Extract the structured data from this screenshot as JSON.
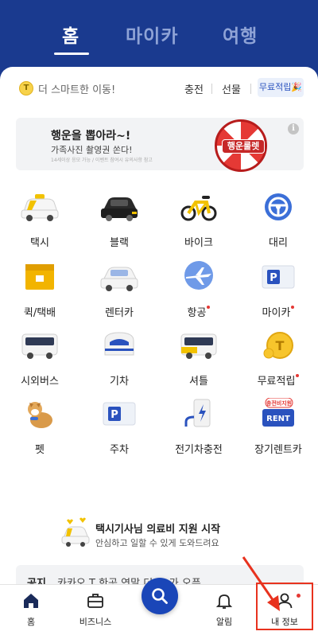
{
  "top_tabs": [
    {
      "label": "홈",
      "active": true
    },
    {
      "label": "마이카",
      "active": false
    },
    {
      "label": "여행",
      "active": false
    }
  ],
  "subbar": {
    "coin": "T",
    "tagline": "더 스마트한 이동!",
    "links": [
      "충전",
      "선물"
    ],
    "free_chip": "무료적립🎉"
  },
  "banner": {
    "title": "행운을 뽑아라~!",
    "subtitle": "가족사진 촬영권 쏜다!",
    "fine_print": "14세이상 응모 가능 / 이벤트 참여시 유의사항 참고",
    "wheel_label": "행운룰렛",
    "info": "i"
  },
  "services": [
    {
      "label": "택시",
      "icon": "taxi-icon",
      "new": false
    },
    {
      "label": "블랙",
      "icon": "black-car-icon",
      "new": false
    },
    {
      "label": "바이크",
      "icon": "bike-icon",
      "new": false
    },
    {
      "label": "대리",
      "icon": "steering-wheel-icon",
      "new": false
    },
    {
      "label": "퀵/택배",
      "icon": "box-icon",
      "new": false
    },
    {
      "label": "렌터카",
      "icon": "rental-car-icon",
      "new": false
    },
    {
      "label": "항공",
      "icon": "airplane-icon",
      "new": true
    },
    {
      "label": "마이카",
      "icon": "parking-ticket-icon",
      "new": true
    },
    {
      "label": "시외버스",
      "icon": "bus-icon",
      "new": false
    },
    {
      "label": "기차",
      "icon": "train-icon",
      "new": false
    },
    {
      "label": "셔틀",
      "icon": "shuttle-icon",
      "new": false
    },
    {
      "label": "무료적립",
      "icon": "coin-icon",
      "new": true
    },
    {
      "label": "펫",
      "icon": "dog-icon",
      "new": false
    },
    {
      "label": "주차",
      "icon": "parking-icon",
      "new": false
    },
    {
      "label": "전기차충전",
      "icon": "ev-charger-icon",
      "new": false
    },
    {
      "label": "장기렌트카",
      "icon": "rent-icon",
      "new": false,
      "badge": "충전비지원",
      "sign": "RENT"
    }
  ],
  "promo": {
    "title": "택시기사님 의료비 지원 시작",
    "subtitle": "안심하고 일할 수 있게 도와드려요"
  },
  "notice": {
    "label": "공지",
    "text": "카카오 T 한곳 연말 더 ... 가 오픈"
  },
  "bottom_nav": [
    {
      "label": "홈",
      "icon": "home-icon",
      "active": true
    },
    {
      "label": "비즈니스",
      "icon": "briefcase-icon",
      "active": false
    },
    {
      "label": "",
      "icon": "search-icon",
      "active": false
    },
    {
      "label": "알림",
      "icon": "bell-icon",
      "active": false
    },
    {
      "label": "내 정보",
      "icon": "person-icon",
      "active": false,
      "new": true
    }
  ],
  "colors": {
    "brand_blue": "#1a3a8f",
    "accent_blue": "#1a46b8",
    "new_dot": "#e53935",
    "annotation_red": "#e8321e"
  }
}
